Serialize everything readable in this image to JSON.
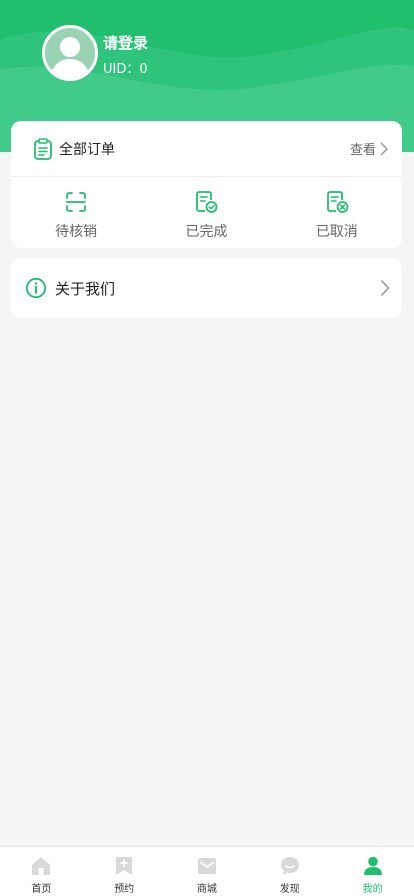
{
  "colors": {
    "brand": "#1fbf6d",
    "background": "#f5f5f5",
    "inactive_icon": "#d9d9d9"
  },
  "profile": {
    "name": "请登录",
    "uid": "UID：0",
    "avatar_icon": "user-silhouette-icon"
  },
  "orders": {
    "title": "全部订单",
    "view_label": "查看",
    "items": [
      {
        "label": "待核销",
        "icon": "scan-icon"
      },
      {
        "label": "已完成",
        "icon": "document-check-icon"
      },
      {
        "label": "已取消",
        "icon": "document-cancel-icon"
      }
    ]
  },
  "about": {
    "label": "关于我们",
    "icon": "info-icon"
  },
  "tabbar": {
    "active": "我的",
    "tabs": [
      {
        "label": "首页",
        "icon": "home-icon"
      },
      {
        "label": "预约",
        "icon": "bookmark-plus-icon"
      },
      {
        "label": "商城",
        "icon": "mail-icon"
      },
      {
        "label": "发现",
        "icon": "chat-icon"
      },
      {
        "label": "我的",
        "icon": "profile-icon"
      }
    ]
  }
}
